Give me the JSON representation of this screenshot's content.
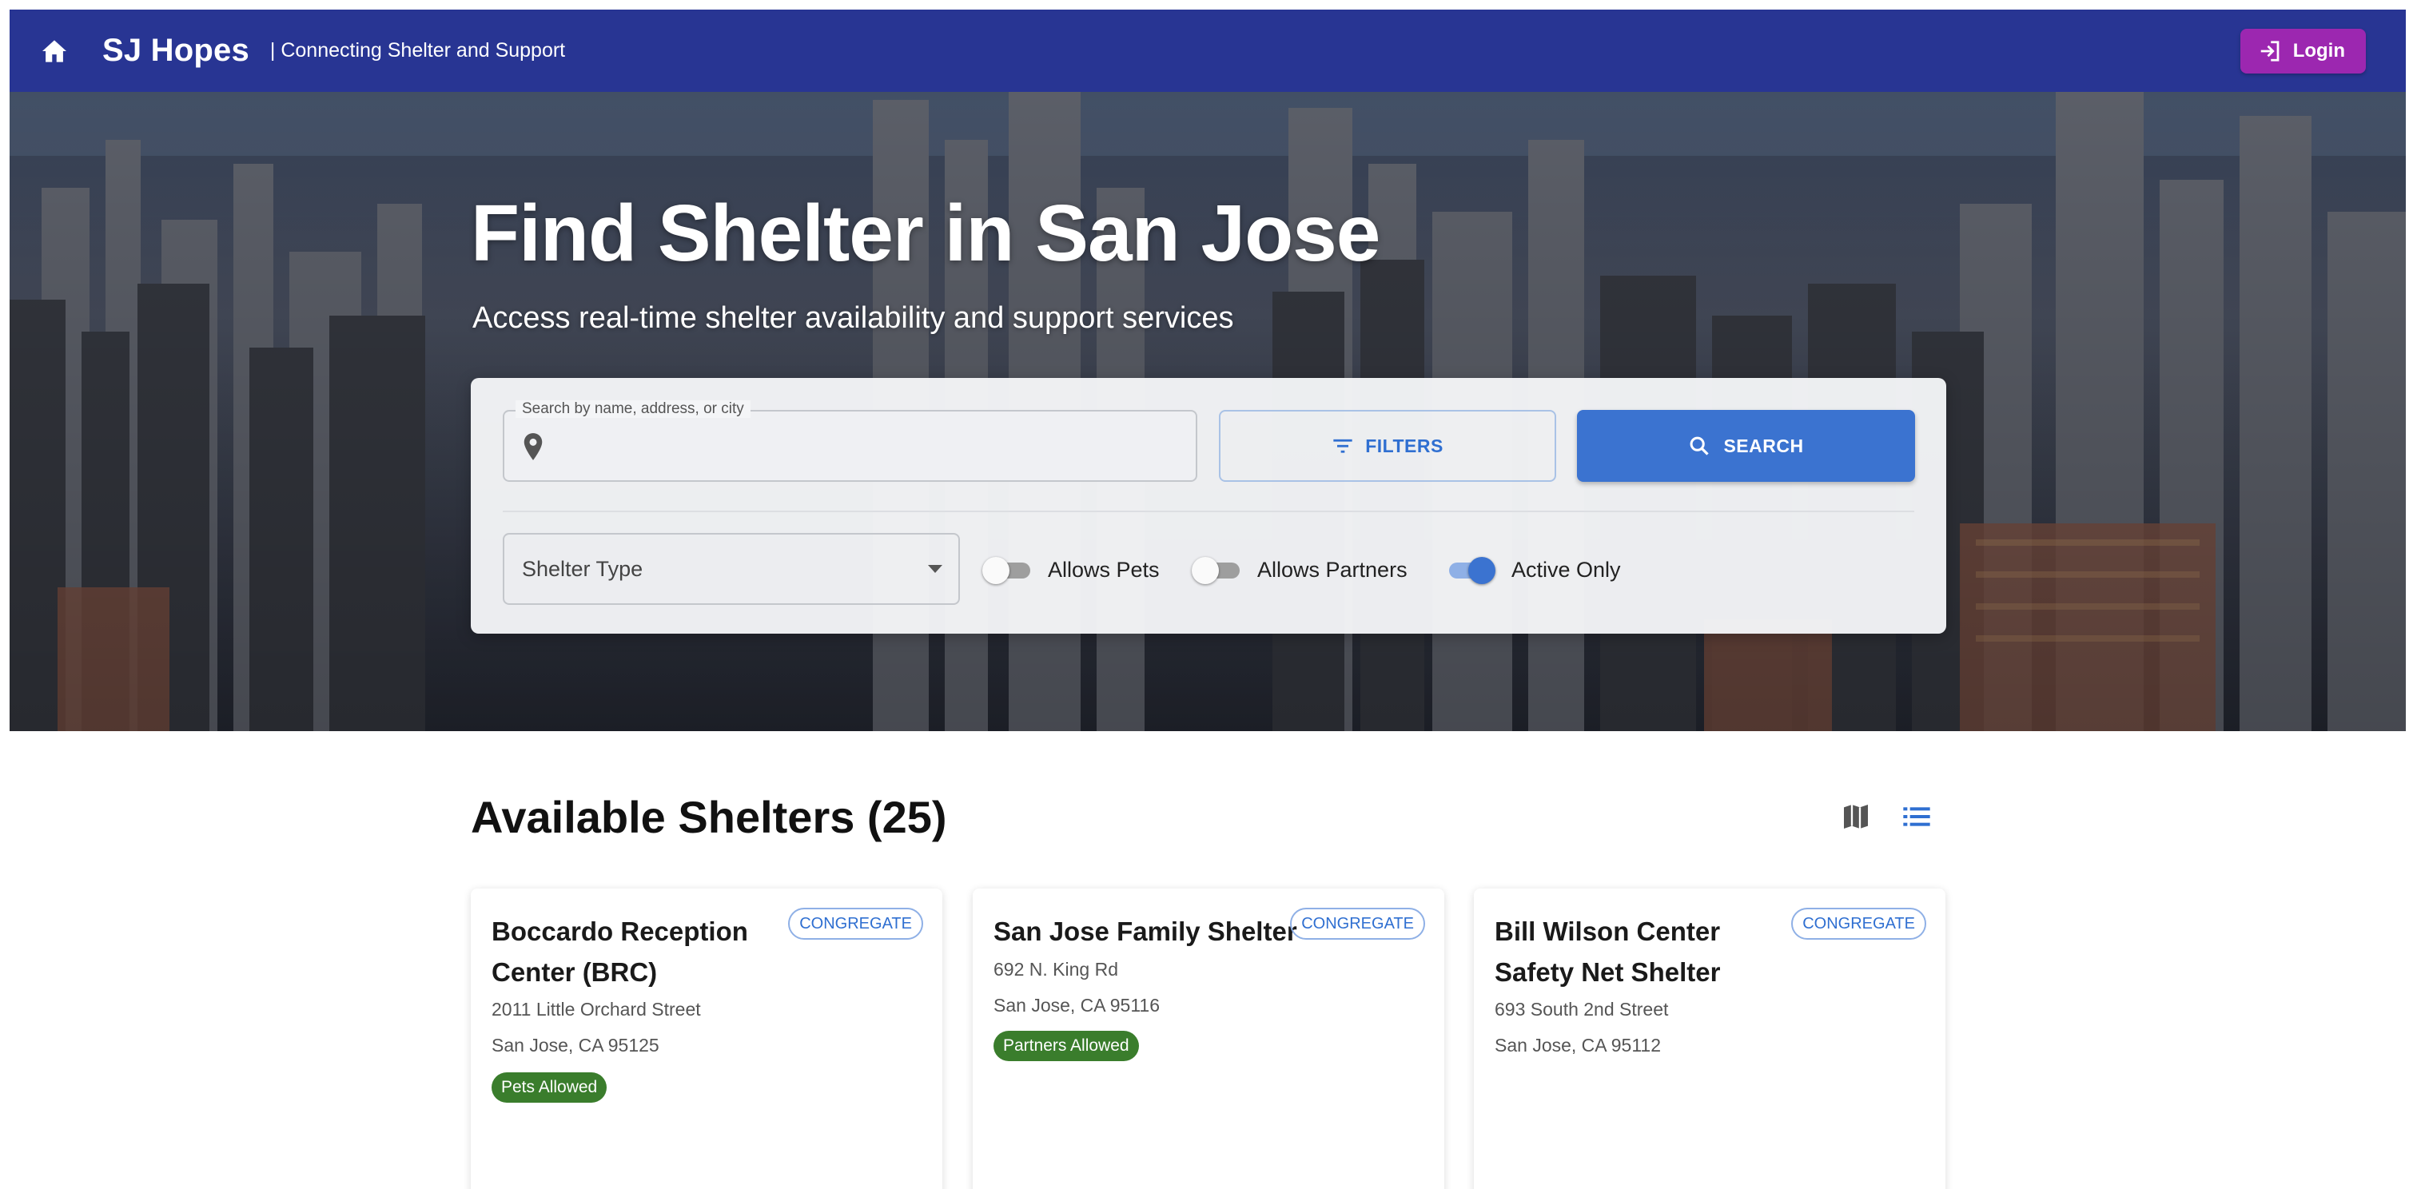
{
  "header": {
    "brand": "SJ Hopes",
    "tagline": "| Connecting Shelter and Support",
    "login_label": "Login"
  },
  "hero": {
    "title": "Find Shelter in San Jose",
    "subtitle": "Access real-time shelter availability and support services"
  },
  "search": {
    "field_label": "Search by name, address, or city",
    "value": "",
    "filters_label": "FILTERS",
    "search_label": "SEARCH",
    "shelter_type_placeholder": "Shelter Type",
    "toggles": [
      {
        "label": "Allows Pets",
        "on": false
      },
      {
        "label": "Allows Partners",
        "on": false
      },
      {
        "label": "Active Only",
        "on": true
      }
    ]
  },
  "results": {
    "title": "Available Shelters (25)",
    "view_options": [
      "map-icon",
      "list-icon"
    ],
    "active_view": "list-icon",
    "cards": [
      {
        "name": "Boccardo Reception Center (BRC)",
        "type": "CONGREGATE",
        "address_line1": "2011 Little Orchard Street",
        "address_line2": "San Jose, CA 95125",
        "feature": "Pets Allowed"
      },
      {
        "name": "San Jose Family Shelter",
        "type": "CONGREGATE",
        "address_line1": "692 N. King Rd",
        "address_line2": "San Jose, CA 95116",
        "feature": "Partners Allowed"
      },
      {
        "name": "Bill Wilson Center Safety Net Shelter",
        "type": "CONGREGATE",
        "address_line1": "693 South 2nd Street",
        "address_line2": "San Jose, CA 95112",
        "feature": ""
      }
    ]
  },
  "colors": {
    "appbar": "#283593",
    "login": "#9c27b0",
    "primary": "#3b73d0",
    "feature_chip": "#3a7d2c"
  }
}
